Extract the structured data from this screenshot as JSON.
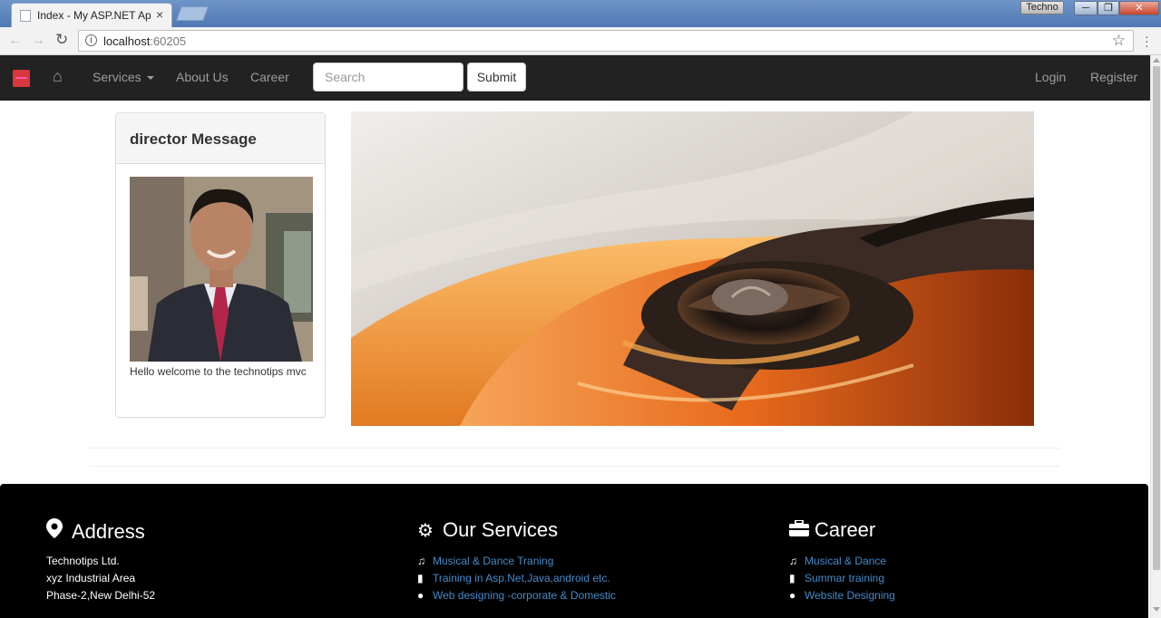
{
  "browser": {
    "tab_title": "Index - My ASP.NET App",
    "tab_close": "×",
    "profile_label": "Techno",
    "win_min": "─",
    "win_max": "❐",
    "win_close": "✕",
    "url_host": "localhost",
    "url_port": ":60205"
  },
  "navbar": {
    "home_icon": "⌂",
    "services_label": "Services",
    "about_label": "About Us",
    "career_label": "Career",
    "search_placeholder": "Search",
    "submit_label": "Submit",
    "login_label": "Login",
    "register_label": "Register"
  },
  "director": {
    "title": "director Message",
    "message": "Hello welcome to the technotips mvc"
  },
  "footer": {
    "address": {
      "heading": "Address",
      "icon": "map-marker-icon",
      "lines": [
        "Technotips Ltd.",
        "xyz Industrial Area",
        "Phase-2,New Delhi-52"
      ]
    },
    "services": {
      "heading": "Our Services",
      "icon": "gear-icon",
      "items": [
        {
          "label": "Musical & Dance Traning",
          "icon": "music-icon"
        },
        {
          "label": "Training in Asp.Net,Java,android etc.",
          "icon": "book-icon"
        },
        {
          "label": "Web designing -corporate & Domestic",
          "icon": "globe-icon"
        }
      ]
    },
    "career": {
      "heading": "Career",
      "icon": "briefcase-icon",
      "items": [
        {
          "label": "Musical & Dance",
          "icon": "music-icon"
        },
        {
          "label": "Summar training",
          "icon": "book-icon"
        },
        {
          "label": "Website Designing",
          "icon": "globe-icon"
        }
      ]
    }
  },
  "colors": {
    "navbar_bg": "#222222",
    "footer_bg": "#000000",
    "link": "#428bca",
    "brand": "#d9363e"
  }
}
